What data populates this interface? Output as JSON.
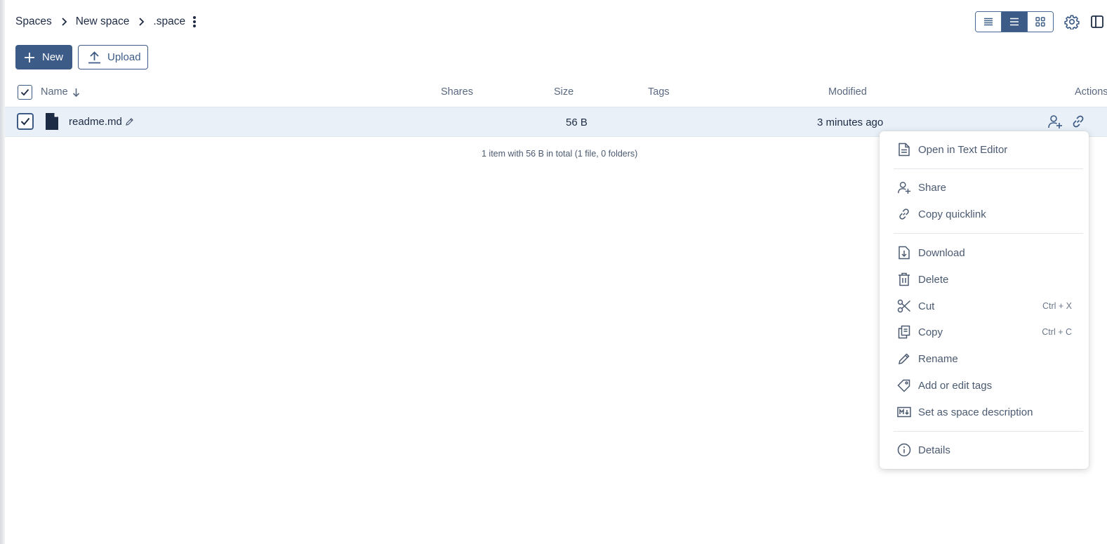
{
  "breadcrumb": {
    "items": [
      "Spaces",
      "New space",
      ".space"
    ]
  },
  "toolbar": {
    "new_label": "New",
    "upload_label": "Upload",
    "view_modes": [
      "condensed-table",
      "table",
      "tiles"
    ],
    "active_view": "table"
  },
  "table": {
    "headers": {
      "name": "Name",
      "shares": "Shares",
      "size": "Size",
      "tags": "Tags",
      "modified": "Modified",
      "actions": "Actions"
    },
    "rows": [
      {
        "name": "readme.md",
        "size": "56 B",
        "modified": "3 minutes ago",
        "selected": true
      }
    ],
    "summary": "1 item with 56 B in total (1 file, 0 folders)"
  },
  "context_menu": {
    "items": [
      {
        "label": "Open in Text Editor",
        "icon": "file-text-icon"
      },
      {
        "label": "Share",
        "icon": "user-add-icon"
      },
      {
        "label": "Copy quicklink",
        "icon": "link-icon"
      },
      {
        "label": "Download",
        "icon": "download-icon"
      },
      {
        "label": "Delete",
        "icon": "trash-icon"
      },
      {
        "label": "Cut",
        "icon": "scissors-icon",
        "shortcut": "Ctrl + X"
      },
      {
        "label": "Copy",
        "icon": "copy-icon",
        "shortcut": "Ctrl + C"
      },
      {
        "label": "Rename",
        "icon": "pencil-icon"
      },
      {
        "label": "Add or edit tags",
        "icon": "tag-icon"
      },
      {
        "label": "Set as space description",
        "icon": "markdown-icon"
      },
      {
        "label": "Details",
        "icon": "info-icon"
      }
    ]
  },
  "colors": {
    "primary": "#3c5b86",
    "text": "#1d2b44",
    "muted": "#4b5a70",
    "row_selected": "#e9f0f8"
  }
}
